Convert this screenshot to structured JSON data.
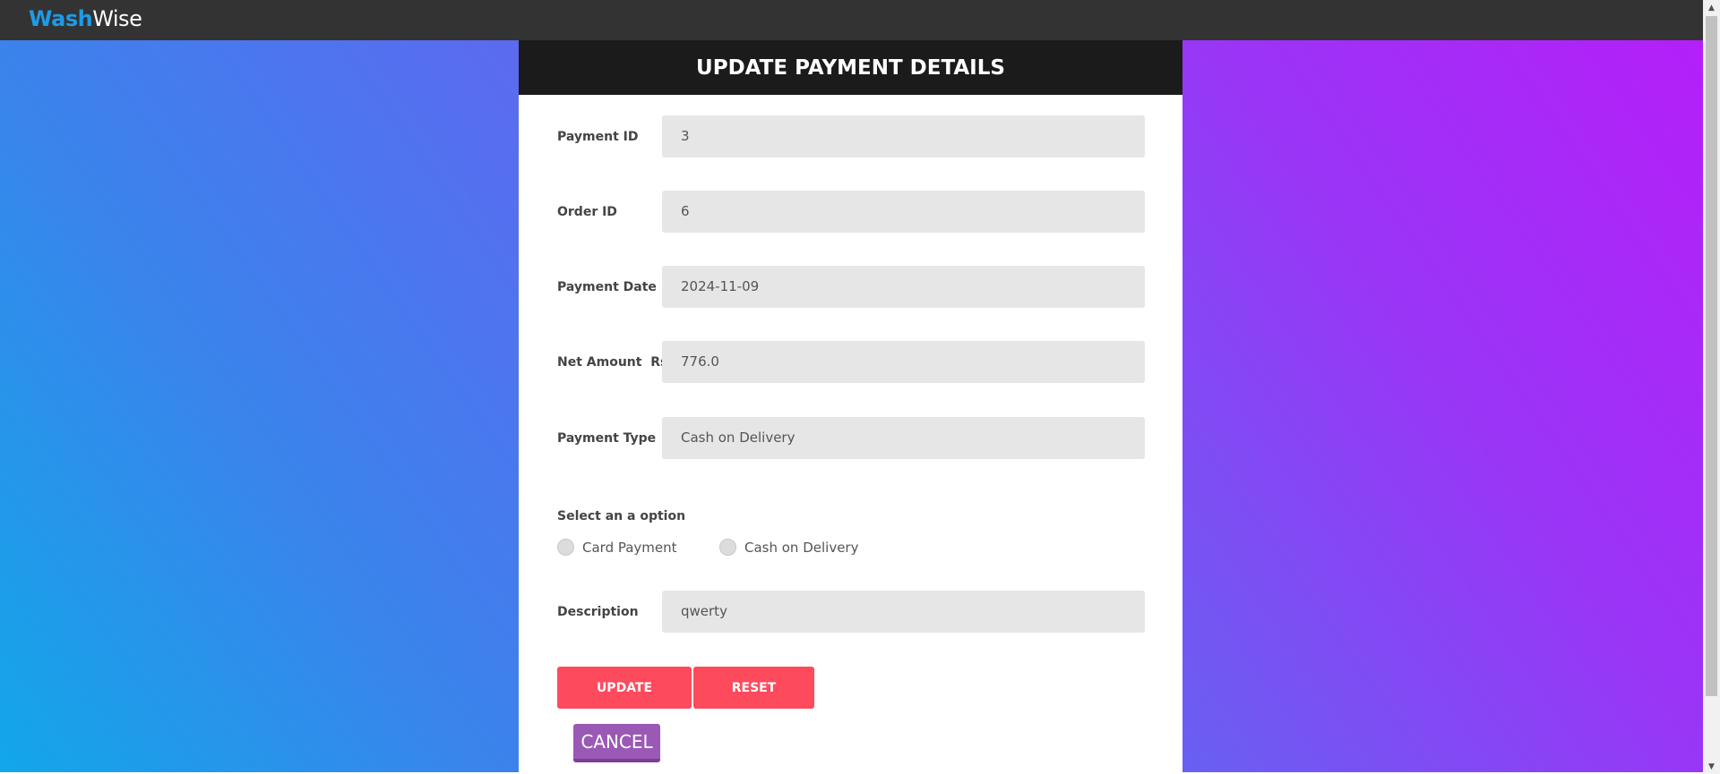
{
  "brand": {
    "part1": "Wash",
    "part2": "Wise"
  },
  "form": {
    "title": "UPDATE PAYMENT DETAILS",
    "fields": [
      {
        "label": "Payment ID",
        "value": "3"
      },
      {
        "label": "Order ID",
        "value": "6"
      },
      {
        "label": "Payment Date",
        "value": "2024-11-09"
      },
      {
        "label": "Net Amount  Rs.",
        "value": "776.0"
      },
      {
        "label": "Payment Type",
        "value": "Cash on Delivery"
      }
    ],
    "option_title": "Select an a option",
    "options": [
      {
        "label": "Card Payment",
        "selected": false
      },
      {
        "label": "Cash on Delivery",
        "selected": false
      }
    ],
    "description": {
      "label": "Description",
      "value": "qwerty"
    },
    "buttons": {
      "update": "UPDATE",
      "reset": "RESET",
      "cancel": "CANCEL"
    }
  },
  "colors": {
    "navbar": "#333333",
    "brand_accent": "#1e9be8",
    "header": "#1b1b1b",
    "primary_button": "#fd4a5c",
    "cancel_button": "#9b59b6",
    "gradient_start": "#12a7e8",
    "gradient_end": "#b41ff9"
  }
}
